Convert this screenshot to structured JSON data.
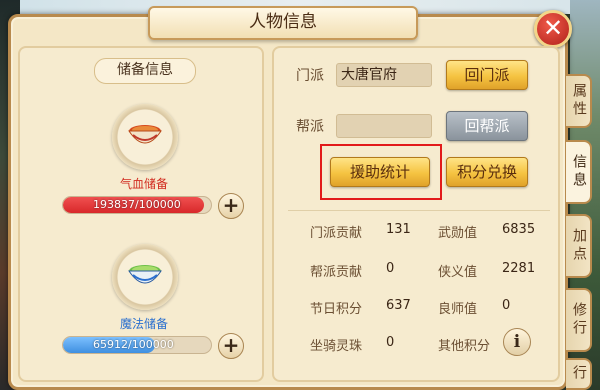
{
  "window": {
    "title": "人物信息"
  },
  "reserve": {
    "heading": "储备信息",
    "hp": {
      "label": "气血储备",
      "value_text": "193837/100000",
      "fill": 0.95
    },
    "mp": {
      "label": "魔法储备",
      "value_text": "65912/100000",
      "fill": 0.62
    }
  },
  "sect": {
    "label": "门派",
    "value": "大唐官府",
    "return_button": "回门派"
  },
  "gang": {
    "label": "帮派",
    "value": "",
    "return_button": "回帮派"
  },
  "actions": {
    "aid_stats_button": "援助统计",
    "points_exchange_button": "积分兑换"
  },
  "stats": {
    "sect_contribution": {
      "label": "门派贡献",
      "value": "131"
    },
    "martial_merit": {
      "label": "武勋值",
      "value": "6835"
    },
    "gang_contribution": {
      "label": "帮派贡献",
      "value": "0"
    },
    "chivalry": {
      "label": "侠义值",
      "value": "2281"
    },
    "holiday_points": {
      "label": "节日积分",
      "value": "637"
    },
    "mentor_value": {
      "label": "良师值",
      "value": "0"
    },
    "mount_pearls": {
      "label": "坐骑灵珠",
      "value": "0"
    },
    "other_points": {
      "label": "其他积分"
    }
  },
  "side_tabs": [
    "属性",
    "信息",
    "加点",
    "修行",
    "行"
  ],
  "icons": {
    "close": "close-icon",
    "plus": "plus-icon",
    "info": "info-icon",
    "hp_bowl": "red-soup-bowl-icon",
    "mp_bowl": "blue-soup-bowl-icon"
  },
  "colors": {
    "hp_bar": "#d8282a",
    "mp_bar": "#3f8fe0",
    "hp_label": "#d12a1e",
    "mp_label": "#2a6fcf",
    "highlight": "#e21a1a"
  },
  "close_glyph": "✕",
  "plus_glyph": "+",
  "info_glyph": "i"
}
